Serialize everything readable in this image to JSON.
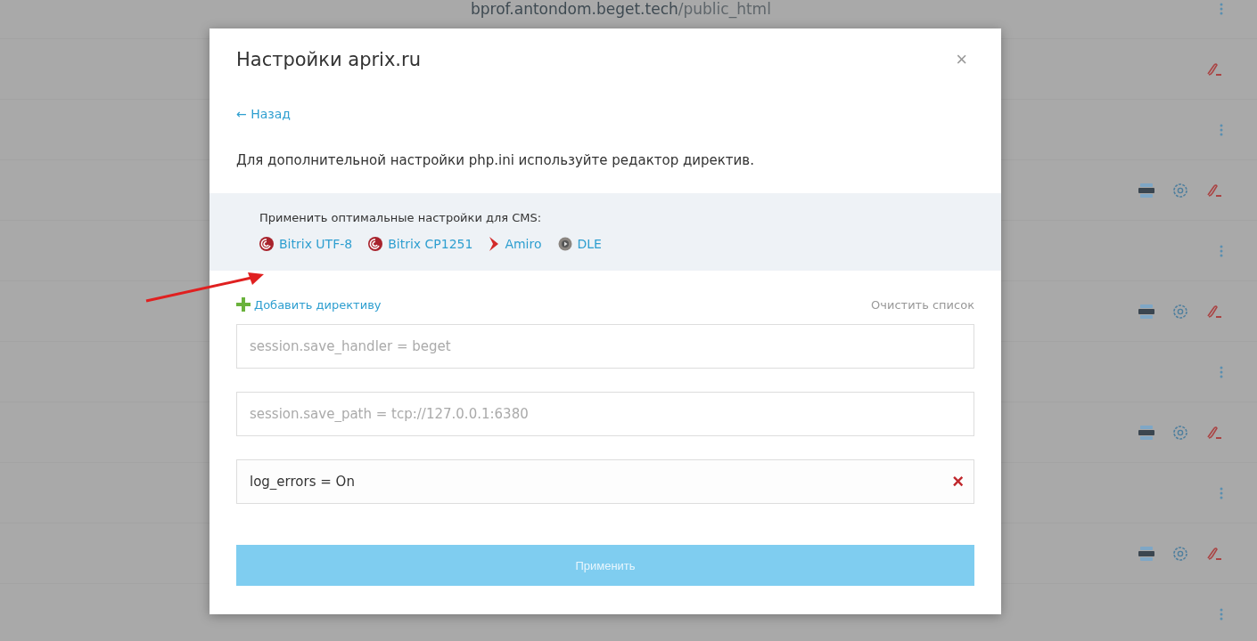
{
  "background": {
    "path_host": "bprof.antondom.beget.tech",
    "path_dir": "/public_html",
    "rows": [
      {
        "kind": "menu"
      },
      {
        "kind": "unlink"
      },
      {
        "kind": "menu"
      },
      {
        "kind": "actions"
      },
      {
        "kind": "menu"
      },
      {
        "kind": "actions"
      },
      {
        "kind": "menu"
      },
      {
        "kind": "actions"
      },
      {
        "kind": "menu"
      },
      {
        "kind": "actions"
      },
      {
        "kind": "menu"
      }
    ]
  },
  "dialog": {
    "title": "Настройки aprix.ru",
    "close": "×",
    "back": "← Назад",
    "intro": "Для дополнительной настройки php.ini используйте редактор директив.",
    "cms": {
      "label": "Применить оптимальные настройки для CMS:",
      "items": [
        {
          "name": "Bitrix UTF-8",
          "kind": "bitrix"
        },
        {
          "name": "Bitrix CP1251",
          "kind": "bitrix"
        },
        {
          "name": "Amiro",
          "kind": "amiro"
        },
        {
          "name": "DLE",
          "kind": "dle"
        }
      ]
    },
    "add": "Добавить директиву",
    "clear": "Очистить список",
    "directives": [
      {
        "placeholder": "session.save_handler = beget"
      },
      {
        "placeholder": "session.save_path = tcp://127.0.0.1:6380"
      },
      {
        "value": "log_errors = On",
        "removable": true,
        "remove": "×"
      }
    ],
    "apply": {
      "label": "Применить",
      "disabled": true
    }
  },
  "annotation": {
    "arrow": true
  }
}
